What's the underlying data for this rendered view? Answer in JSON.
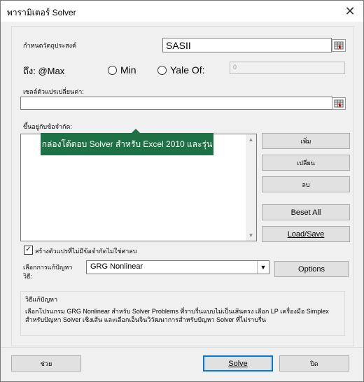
{
  "title": "พารามิเตอร์ Solver",
  "close_glyph": "✕",
  "objective": {
    "label": "กำหนดวัตถุประสงค์",
    "value": "SASII"
  },
  "to": {
    "label": "ถึง: @Max",
    "min_label": "Min",
    "value_of_label": "Yale Of:",
    "value_of_value": "0"
  },
  "variable_cells": {
    "label": "เซลล์ตัวแปรเปลี่ยนค่า:",
    "value": ""
  },
  "constraints": {
    "label": "ขึ้นอยู่กับข้อจำกัด:",
    "add_label": "เพิ่ม",
    "change_label": "เปลี่ยน",
    "delete_label": "ลบ",
    "reset_all_label": "Beset All",
    "load_save_label": "Load/Save"
  },
  "tooltip": "กล่องโต้ตอบ Solver สำหรับ Excel 2010 และรุ่น",
  "make_nonnegative": {
    "label": "สร้างตัวแปรที่ไม่มีข้อจำกัดไม่ใช่ศาลบ",
    "checked": true,
    "check_glyph": "✓"
  },
  "solving_method": {
    "label_line1": "เลือกการแก้ปัญหา",
    "label_line2": "วิธี:",
    "selected": "GRG Nonlinear",
    "options_label": "Options"
  },
  "method_description": {
    "title": "วิธีแก้ปัญหา",
    "text": "เลือกโปรแกรม GRG Nonlinear สำหรับ Solver Problems ที่ราบรื่นแบบไม่เป็นเส้นตรง เลือก LP เครื่องมือ Simplex สำหรับปัญหา Solver เชิงเส้น และเลือกเอ็นจินวิวัฒนาการสำหรับปัญหา Solver ที่ไม่ราบรื่น"
  },
  "footer": {
    "help_label": "ช่วย",
    "solve_label": "Solve",
    "close_label": "ปิด"
  },
  "colors": {
    "tooltip_bg": "#1e7145",
    "accent": "#0078d7"
  }
}
